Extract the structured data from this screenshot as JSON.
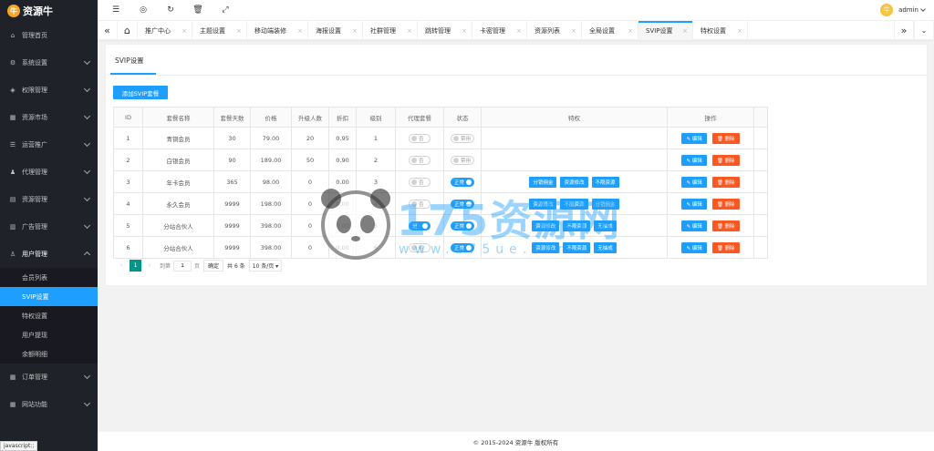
{
  "brand": {
    "logo_mark": "牛",
    "name": "资源牛"
  },
  "sidebar": {
    "items": [
      {
        "icon": "home-icon",
        "glyph": "⌂",
        "label": "管理首页"
      },
      {
        "icon": "gear-icon",
        "glyph": "⚙",
        "label": "系统设置"
      },
      {
        "icon": "shield-icon",
        "glyph": "◈",
        "label": "权限管理"
      },
      {
        "icon": "store-icon",
        "glyph": "▦",
        "label": "资源市场"
      },
      {
        "icon": "list-icon",
        "glyph": "☰",
        "label": "运营推广"
      },
      {
        "icon": "agent-icon",
        "glyph": "♟",
        "label": "代理管理"
      },
      {
        "icon": "file-icon",
        "glyph": "▤",
        "label": "资源管理"
      },
      {
        "icon": "ad-icon",
        "glyph": "▥",
        "label": "广告管理"
      },
      {
        "icon": "user-icon",
        "glyph": "♙",
        "label": "用户管理"
      },
      {
        "icon": "order-icon",
        "glyph": "▦",
        "label": "订单管理"
      },
      {
        "icon": "grid-icon",
        "glyph": "▦",
        "label": "网站功能"
      }
    ],
    "sub_items": [
      {
        "label": "会员列表"
      },
      {
        "label": "SVIP设置"
      },
      {
        "label": "特权设置"
      },
      {
        "label": "用户提现"
      },
      {
        "label": "余额明细"
      }
    ]
  },
  "status_bar": "javascript:;",
  "header": {
    "user": "admin",
    "avatar": "牛"
  },
  "tabs": [
    {
      "label": "推广中心"
    },
    {
      "label": "主题设置"
    },
    {
      "label": "移动端装修"
    },
    {
      "label": "海报设置"
    },
    {
      "label": "社群管理"
    },
    {
      "label": "跳转管理"
    },
    {
      "label": "卡密管理"
    },
    {
      "label": "资源列表"
    },
    {
      "label": "全局设置"
    },
    {
      "label": "SVIP设置"
    },
    {
      "label": "特权设置"
    }
  ],
  "page": {
    "title": "SVIP设置",
    "add_button": "添加SVIP套餐"
  },
  "table": {
    "headers": [
      "ID",
      "套餐名称",
      "套餐天数",
      "价格",
      "升级人数",
      "折扣",
      "级别",
      "代理套餐",
      "状态",
      "特权",
      "操作"
    ],
    "rows": [
      {
        "id": "1",
        "name": "青铜会员",
        "days": "30",
        "price": "79.00",
        "upgrades": "20",
        "discount": "0.95",
        "level": "1",
        "agent": "否",
        "status": "禁用",
        "privileges": []
      },
      {
        "id": "2",
        "name": "白银会员",
        "days": "90",
        "price": "189.00",
        "upgrades": "50",
        "discount": "0.90",
        "level": "2",
        "agent": "否",
        "status": "禁用",
        "privileges": []
      },
      {
        "id": "3",
        "name": "年卡会员",
        "days": "365",
        "price": "98.00",
        "upgrades": "0",
        "discount": "0.00",
        "level": "3",
        "agent": "否",
        "status": "正常",
        "privileges": [
          "分销佣金",
          "资源修改",
          "不限资源"
        ]
      },
      {
        "id": "4",
        "name": "永久会员",
        "days": "9999",
        "price": "198.00",
        "upgrades": "0",
        "discount": "0.00",
        "level": "4",
        "agent": "否",
        "status": "正常",
        "privileges": [
          "资源修改",
          "不限资源",
          "分销佣金"
        ]
      },
      {
        "id": "5",
        "name": "分站合伙人",
        "days": "9999",
        "price": "398.00",
        "upgrades": "0",
        "discount": "0.00",
        "level": "5",
        "agent": "是",
        "status": "正常",
        "privileges": [
          "资源修改",
          "不限资源",
          "无抽成"
        ]
      },
      {
        "id": "6",
        "name": "分站合伙人",
        "days": "9999",
        "price": "398.00",
        "upgrades": "0",
        "discount": "0.00",
        "level": "6",
        "agent": "否",
        "status": "正常",
        "privileges": [
          "资源修改",
          "不限资源",
          "无抽成"
        ]
      }
    ],
    "edit_label": "编辑",
    "delete_label": "删除"
  },
  "pagination": {
    "current": "1",
    "goto_label": "到第",
    "page_value": "1",
    "page_unit": "页",
    "confirm": "确定",
    "total": "共 6 条",
    "page_size": "10 条/页"
  },
  "footer": "© 2015-2024 资源牛 版权所有",
  "watermark": {
    "main": "175资源网",
    "sub": "www.175ue.com"
  },
  "colors": {
    "primary": "#1e9fff",
    "danger": "#ff5722",
    "pager": "#009688",
    "sidebar_bg": "#20222a"
  }
}
